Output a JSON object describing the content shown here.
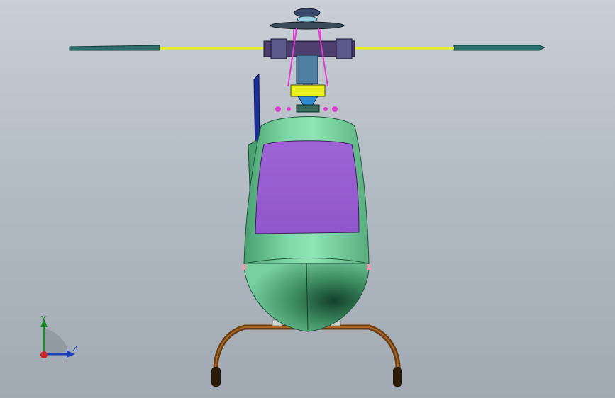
{
  "viewport": {
    "background_top": "#c9cfd6",
    "background_bottom": "#a1a9b2"
  },
  "model": {
    "body_color": "#6fc798",
    "body_highlight": "#8ee6b4",
    "body_shadow": "#1e5a3d",
    "window_color": "#9a5fd0",
    "rotor_mast_color": "#e8ef1a",
    "blade_color": "#2b6f6b",
    "skid_color": "#6b3d12",
    "tail_color": "#1d2f9a",
    "link_color": "#e23cd0"
  },
  "triad": {
    "y_label": "Y",
    "z_label": "Z",
    "y_color": "#1d8a2a",
    "z_color": "#1c3fb8",
    "x_color": "#d0202a"
  }
}
